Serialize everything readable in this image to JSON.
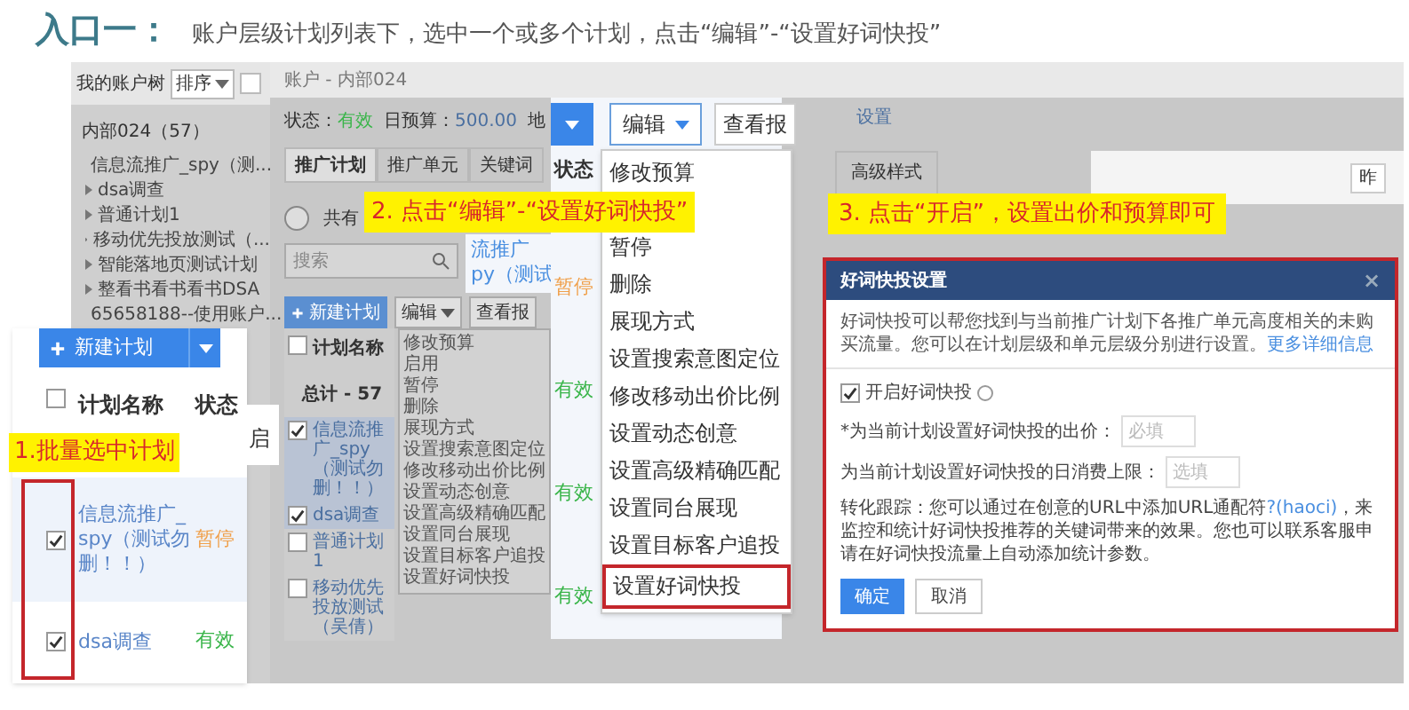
{
  "heading": {
    "label": "入口一：",
    "text": "账户层级计划列表下，选中一个或多个计划，点击“编辑”-“设置好词快投”"
  },
  "account_tree": {
    "title": "我的账户树",
    "sort_button": "排序",
    "root": "内部024（57）",
    "items": [
      {
        "label": "信息流推广_spy（测..."
      },
      {
        "label": "dsa调查"
      },
      {
        "label": "普通计划1"
      },
      {
        "label": "移动优先投放测试（..."
      },
      {
        "label": "智能落地页测试计划"
      },
      {
        "label": "整看书看书看书DSA"
      },
      {
        "label": "65658188--使用账户..."
      }
    ]
  },
  "breadcrumb": "账户 - 内部024",
  "status": {
    "label": "状态：",
    "value": "有效"
  },
  "budget": {
    "label": "日预算：",
    "value": "500.00"
  },
  "region_label": "地",
  "tabs": [
    {
      "label": "推广计划",
      "selected": true
    },
    {
      "label": "推广单元",
      "selected": false
    },
    {
      "label": "关键词",
      "selected": false
    }
  ],
  "summary_text": "共有",
  "search": {
    "placeholder": "搜索"
  },
  "toolbar": {
    "new_plan": "新建计划",
    "edit": "编辑",
    "report": "查看报"
  },
  "plan_table": {
    "column": "计划名称",
    "header_checked": false,
    "total": "总计 - 57",
    "rows": [
      {
        "name": "信息流推广_spy（测试勿删！！）",
        "checked": true
      },
      {
        "name": "dsa调查",
        "checked": true
      },
      {
        "name": "普通计划1",
        "checked": false
      },
      {
        "name": "移动优先投放测试（吴倩）",
        "checked": false
      }
    ]
  },
  "small_menu": [
    "修改预算",
    "启用",
    "暂停",
    "删除",
    "展现方式",
    "设置搜索意图定位",
    "修改移动出价比例",
    "设置动态创意",
    "设置高级精确匹配",
    "设置同台展现",
    "设置目标客户追投",
    "设置好词快投"
  ],
  "right_panel": {
    "link": "设置",
    "tab": "高级样式",
    "column": "昨"
  },
  "zoom_table": {
    "new_plan": "新建计划",
    "columns": [
      "计划名称",
      "状态"
    ],
    "header_checked": false,
    "side_text": "启",
    "rows": [
      {
        "name": "信息流推广_spy（测试勿删！！）",
        "status": "暂停",
        "kind": "paused",
        "checked": true
      },
      {
        "name": "dsa调查",
        "status": "有效",
        "kind": "active",
        "checked": true
      }
    ]
  },
  "zoom_menu": {
    "edit": "编辑",
    "report": "查看报",
    "plan_fragment": [
      "流推广",
      "py（测试"
    ],
    "status_column": "状态",
    "statuses": [
      {
        "label": "暂停",
        "kind": "paused"
      },
      {
        "label": "有效",
        "kind": "active"
      },
      {
        "label": "有效",
        "kind": "active"
      },
      {
        "label": "有效",
        "kind": "active"
      }
    ],
    "items": [
      {
        "label": "修改预算",
        "highlighted": false
      },
      {
        "label": "暂停",
        "highlighted": false
      },
      {
        "label": "删除",
        "highlighted": false
      },
      {
        "label": "展现方式",
        "highlighted": false
      },
      {
        "label": "设置搜索意图定位",
        "highlighted": false
      },
      {
        "label": "修改移动出价比例",
        "highlighted": false
      },
      {
        "label": "设置动态创意",
        "highlighted": false
      },
      {
        "label": "设置高级精确匹配",
        "highlighted": false
      },
      {
        "label": "设置同台展现",
        "highlighted": false
      },
      {
        "label": "设置目标客户追投",
        "highlighted": false
      },
      {
        "label": "设置好词快投",
        "highlighted": true
      }
    ]
  },
  "callouts": [
    "1.批量选中计划",
    "2. 点击“编辑”-“设置好词快投”",
    "3. 点击“开启”，设置出价和预算即可"
  ],
  "dialog": {
    "title": "好词快投设置",
    "close": "×",
    "intro": "好词快投可以帮您找到与当前推广计划下各推广单元高度相关的未购买流量。您可以在计划层级和单元层级分别进行设置。",
    "intro_link": "更多详细信息",
    "enable": {
      "label": "开启好词快投",
      "checked": true
    },
    "fields": [
      {
        "label": "*为当前计划设置好词快投的出价：",
        "placeholder": "必填"
      },
      {
        "label": "为当前计划设置好词快投的日消费上限：",
        "placeholder": "选填"
      }
    ],
    "tracking": {
      "before": "转化跟踪：您可以通过在创意的URL中添加URL通配符",
      "link": "?(haoci)",
      "after": "，来监控和统计好词快投推荐的关键词带来的效果。您也可以联系客服申请在好词快投流量上自动添加统计参数。"
    },
    "confirm": "确定",
    "cancel": "取消"
  }
}
